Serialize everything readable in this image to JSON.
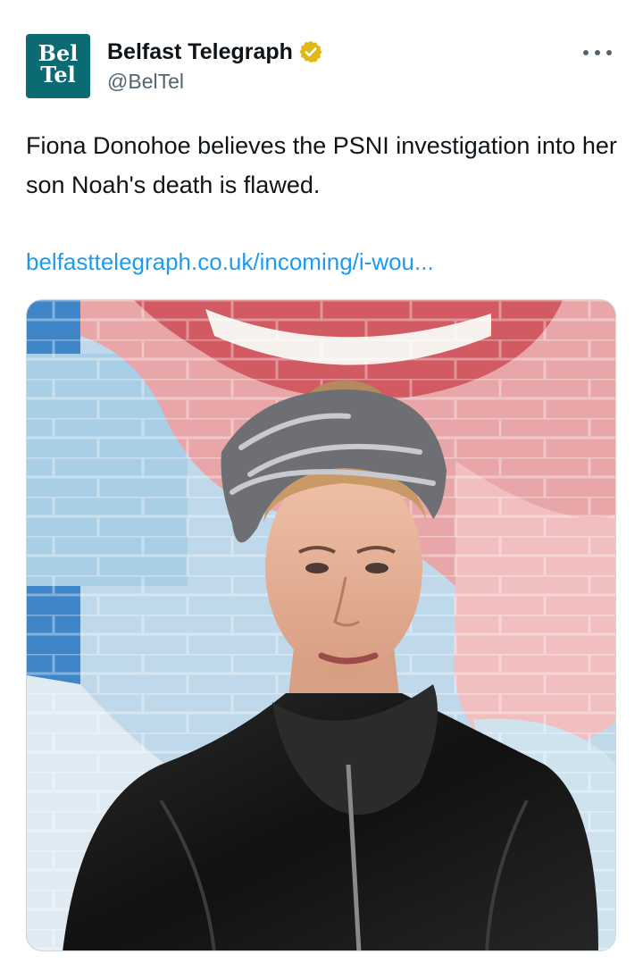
{
  "account": {
    "avatar_line1": "Bel",
    "avatar_line2": "Tel",
    "display_name": "Belfast Telegraph",
    "handle": "@BelTel",
    "verified_icon": "verified-badge-gold"
  },
  "tweet": {
    "text": "Fiona Donohoe believes the PSNI investigation into her son Noah's death is flawed.",
    "link": "belfasttelegraph.co.uk/incoming/i-wou..."
  },
  "colors": {
    "link": "#1d9bf0",
    "avatar_bg": "#0b6b72",
    "verified": "#e2b719"
  }
}
